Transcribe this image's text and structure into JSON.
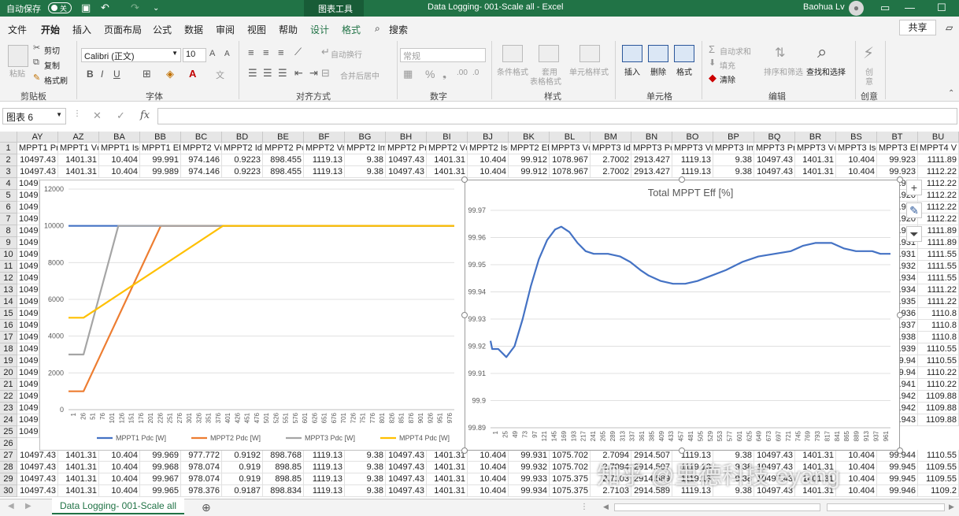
{
  "titlebar": {
    "autosave_label": "自动保存",
    "autosave_state": "关",
    "chart_tools_label": "图表工具",
    "doc_title": "Data Logging- 001-Scale all  -  Excel",
    "user_name": "Baohua Lv"
  },
  "menu": {
    "tabs": [
      "文件",
      "开始",
      "插入",
      "页面布局",
      "公式",
      "数据",
      "审阅",
      "视图",
      "帮助",
      "设计",
      "格式"
    ],
    "search_label": "搜索",
    "share_label": "共享"
  },
  "ribbon": {
    "clipboard": {
      "paste": "粘贴",
      "cut": "剪切",
      "copy": "复制",
      "format_painter": "格式刷",
      "group": "剪贴板"
    },
    "font": {
      "name": "Calibri (正文)",
      "size": "10",
      "group": "字体"
    },
    "alignment": {
      "wrap": "自动换行",
      "merge": "合并后居中",
      "group": "对齐方式"
    },
    "number": {
      "format": "常规",
      "group": "数字"
    },
    "styles": {
      "cond": "条件格式",
      "table": "套用\n表格格式",
      "cell": "单元格样式",
      "group": "样式"
    },
    "cells": {
      "insert": "插入",
      "delete": "删除",
      "format": "格式",
      "group": "单元格"
    },
    "editing": {
      "autosum": "自动求和",
      "fill": "填充",
      "clear": "清除",
      "sort": "排序和筛选",
      "find": "查找和选择",
      "group": "编辑"
    },
    "create": {
      "label": "创\n意",
      "group": "创意"
    }
  },
  "formula_bar": {
    "name_box": "图表 6",
    "fx": "fx",
    "content": ""
  },
  "columns": [
    "AY",
    "AZ",
    "BA",
    "BB",
    "BC",
    "BD",
    "BE",
    "BF",
    "BG",
    "BH",
    "BI",
    "BJ",
    "BK",
    "BL",
    "BM",
    "BN",
    "BO",
    "BP",
    "BQ",
    "BR",
    "BS",
    "BT",
    "BU"
  ],
  "row_numbers": [
    "1",
    "2",
    "3",
    "4",
    "5",
    "6",
    "7",
    "8",
    "9",
    "10",
    "11",
    "12",
    "13",
    "14",
    "15",
    "16",
    "17",
    "18",
    "19",
    "20",
    "21",
    "22",
    "23",
    "24",
    "25",
    "26",
    "27",
    "28",
    "29",
    "30"
  ],
  "header_row": [
    "MPPT1 Pr",
    "MPPT1 Vc",
    "MPPT1 Isc",
    "MPPT1 Eff",
    "MPPT2 Vc",
    "MPPT2 Idc",
    "MPPT2 Pc",
    "MPPT2 Vr",
    "MPPT2 Im",
    "MPPT2 Pr",
    "MPPT2 Vc",
    "MPPT2 Isc",
    "MPPT2 Eff",
    "MPPT3 Vc",
    "MPPT3 Idc",
    "MPPT3 Pc",
    "MPPT3 Vr",
    "MPPT3 Im",
    "MPPT3 Pr",
    "MPPT3 Vc",
    "MPPT3 Isc",
    "MPPT3 Eff",
    "MPPT4 V"
  ],
  "top_rows": [
    [
      "10497.43",
      "1401.31",
      "10.404",
      "99.991",
      "974.146",
      "0.9223",
      "898.455",
      "1119.13",
      "9.38",
      "10497.43",
      "1401.31",
      "10.404",
      "99.912",
      "1078.967",
      "2.7002",
      "2913.427",
      "1119.13",
      "9.38",
      "10497.43",
      "1401.31",
      "10.404",
      "99.923",
      "1111.89"
    ],
    [
      "10497.43",
      "1401.31",
      "10.404",
      "99.989",
      "974.146",
      "0.9223",
      "898.455",
      "1119.13",
      "9.38",
      "10497.43",
      "1401.31",
      "10.404",
      "99.912",
      "1078.967",
      "2.7002",
      "2913.427",
      "1119.13",
      "9.38",
      "10497.43",
      "1401.31",
      "10.404",
      "99.923",
      "1112.22"
    ]
  ],
  "left_partial": [
    "1049",
    "1049",
    "1049",
    "1049",
    "1049",
    "1049",
    "1049",
    "1049",
    "1049",
    "1049",
    "1049",
    "1049",
    "1049",
    "1049",
    "1049",
    "1049",
    "1049",
    "1049",
    "1049",
    "1049",
    "1049",
    "1049"
  ],
  "right_partial": [
    [
      "99.920",
      "1112.22"
    ],
    [
      "99.920",
      "1112.22"
    ],
    [
      "99.920",
      "1112.22"
    ],
    [
      "99.920",
      "1112.22"
    ],
    [
      "99.920",
      "1111.89"
    ],
    [
      "99.931",
      "1111.89"
    ],
    [
      "99.931",
      "1111.55"
    ],
    [
      "99.932",
      "1111.55"
    ],
    [
      "99.934",
      "1111.55"
    ],
    [
      "99.934",
      "1111.22"
    ],
    [
      "99.935",
      "1111.22"
    ],
    [
      "99.936",
      "1110.8"
    ],
    [
      "99.937",
      "1110.8"
    ],
    [
      "99.938",
      "1110.8"
    ],
    [
      "99.939",
      "1110.55"
    ],
    [
      "99.94",
      "1110.55"
    ],
    [
      "99.94",
      "1110.22"
    ],
    [
      "99.941",
      "1110.22"
    ],
    [
      "99.942",
      "1109.88"
    ],
    [
      "99.942",
      "1109.88"
    ],
    [
      "99.943",
      "1109.88"
    ]
  ],
  "bottom_rows": [
    [
      "10497.43",
      "1401.31",
      "10.404",
      "99.969",
      "977.772",
      "0.9192",
      "898.768",
      "1119.13",
      "9.38",
      "10497.43",
      "1401.31",
      "10.404",
      "99.931",
      "1075.702",
      "2.7094",
      "2914.507",
      "1119.13",
      "9.38",
      "10497.43",
      "1401.31",
      "10.404",
      "99.944",
      "1110.55"
    ],
    [
      "10497.43",
      "1401.31",
      "10.404",
      "99.968",
      "978.074",
      "0.919",
      "898.85",
      "1119.13",
      "9.38",
      "10497.43",
      "1401.31",
      "10.404",
      "99.932",
      "1075.702",
      "2.7094",
      "2914.507",
      "1119.13",
      "9.38",
      "10497.43",
      "1401.31",
      "10.404",
      "99.945",
      "1109.55"
    ],
    [
      "10497.43",
      "1401.31",
      "10.404",
      "99.967",
      "978.074",
      "0.919",
      "898.85",
      "1119.13",
      "9.38",
      "10497.43",
      "1401.31",
      "10.404",
      "99.933",
      "1075.375",
      "2.7103",
      "2914.589",
      "1119.13",
      "9.38",
      "10497.43",
      "1401.31",
      "10.404",
      "99.945",
      "1109.55"
    ],
    [
      "10497.43",
      "1401.31",
      "10.404",
      "99.965",
      "978.376",
      "0.9187",
      "898.834",
      "1119.13",
      "9.38",
      "10497.43",
      "1401.31",
      "10.404",
      "99.934",
      "1075.375",
      "2.7103",
      "2914.589",
      "1119.13",
      "9.38",
      "10497.43",
      "1401.31",
      "10.404",
      "99.946",
      "1109.2"
    ]
  ],
  "chart_data": [
    {
      "type": "line",
      "title": "",
      "ylim": [
        0,
        12000
      ],
      "yticks": [
        "0",
        "2000",
        "4000",
        "6000",
        "8000",
        "10000",
        "12000"
      ],
      "xticks": [
        "1",
        "26",
        "51",
        "76",
        "101",
        "126",
        "151",
        "176",
        "201",
        "226",
        "251",
        "276",
        "301",
        "326",
        "351",
        "376",
        "401",
        "426",
        "451",
        "476",
        "501",
        "526",
        "551",
        "576",
        "601",
        "626",
        "651",
        "676",
        "701",
        "726",
        "751",
        "776",
        "801",
        "826",
        "851",
        "876",
        "901",
        "926",
        "951",
        "976"
      ],
      "x_max": 1000,
      "legend": "bottom",
      "series": [
        {
          "name": "MPPT1 Pdc [W]",
          "color": "#4472c4",
          "points": [
            [
              1,
              10000
            ],
            [
              1000,
              10000
            ]
          ]
        },
        {
          "name": "MPPT2 Pdc [W]",
          "color": "#ed7d31",
          "points": [
            [
              1,
              1000
            ],
            [
              40,
              1000
            ],
            [
              240,
              10000
            ],
            [
              1000,
              10000
            ]
          ]
        },
        {
          "name": "MPPT3 Pdc [W]",
          "color": "#a5a5a5",
          "points": [
            [
              1,
              3000
            ],
            [
              40,
              3000
            ],
            [
              130,
              10000
            ],
            [
              1000,
              10000
            ]
          ]
        },
        {
          "name": "MPPT4 Pdc [W]",
          "color": "#ffc000",
          "points": [
            [
              1,
              5000
            ],
            [
              40,
              5000
            ],
            [
              401,
              10000
            ],
            [
              1000,
              10000
            ]
          ]
        }
      ]
    },
    {
      "type": "line",
      "title": "Total MPPT Eff [%]",
      "ylim": [
        99.89,
        99.97
      ],
      "yticks": [
        "99.89",
        "99.9",
        "99.91",
        "99.92",
        "99.93",
        "99.94",
        "99.95",
        "99.96",
        "99.97"
      ],
      "xticks": [
        "1",
        "25",
        "49",
        "73",
        "97",
        "121",
        "145",
        "169",
        "193",
        "217",
        "241",
        "265",
        "289",
        "313",
        "337",
        "361",
        "385",
        "409",
        "433",
        "457",
        "481",
        "505",
        "529",
        "553",
        "577",
        "601",
        "625",
        "649",
        "673",
        "697",
        "721",
        "745",
        "769",
        "793",
        "817",
        "841",
        "865",
        "889",
        "913",
        "937",
        "961"
      ],
      "x_max": 985,
      "legend": "none",
      "series": [
        {
          "name": "",
          "color": "#4472c4",
          "points": [
            [
              1,
              99.922
            ],
            [
              5,
              99.919
            ],
            [
              20,
              99.919
            ],
            [
              40,
              99.916
            ],
            [
              60,
              99.92
            ],
            [
              80,
              99.93
            ],
            [
              100,
              99.942
            ],
            [
              120,
              99.952
            ],
            [
              140,
              99.959
            ],
            [
              160,
              99.963
            ],
            [
              175,
              99.964
            ],
            [
              195,
              99.962
            ],
            [
              215,
              99.958
            ],
            [
              235,
              99.955
            ],
            [
              255,
              99.954
            ],
            [
              290,
              99.954
            ],
            [
              320,
              99.953
            ],
            [
              345,
              99.951
            ],
            [
              370,
              99.948
            ],
            [
              390,
              99.946
            ],
            [
              420,
              99.944
            ],
            [
              450,
              99.943
            ],
            [
              480,
              99.943
            ],
            [
              510,
              99.944
            ],
            [
              545,
              99.946
            ],
            [
              580,
              99.948
            ],
            [
              620,
              99.951
            ],
            [
              660,
              99.953
            ],
            [
              700,
              99.954
            ],
            [
              740,
              99.955
            ],
            [
              770,
              99.957
            ],
            [
              800,
              99.958
            ],
            [
              840,
              99.958
            ],
            [
              870,
              99.956
            ],
            [
              900,
              99.955
            ],
            [
              940,
              99.955
            ],
            [
              960,
              99.954
            ],
            [
              985,
              99.954
            ]
          ]
        }
      ]
    }
  ],
  "sheet_tab": "Data Logging- 001-Scale all",
  "watermark": "知乎 @里德科技 eyang"
}
